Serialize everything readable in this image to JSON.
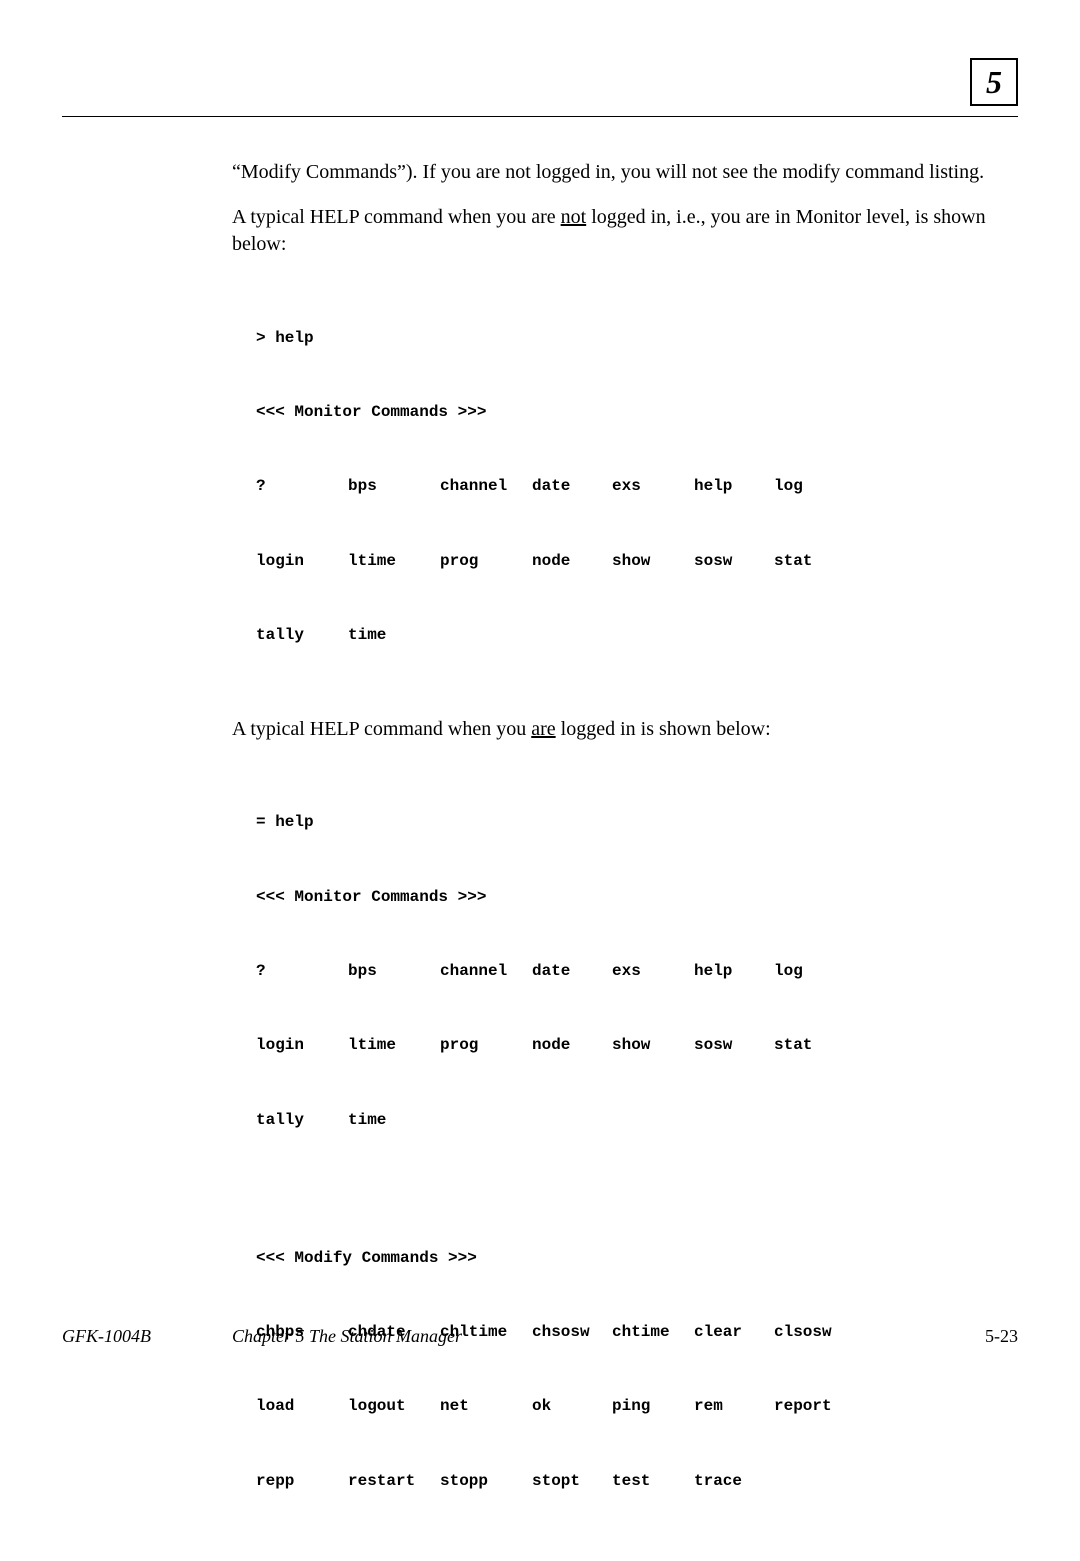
{
  "chapter_num": "5",
  "para1_a": "“Modify Commands”).  If you are not logged in, you will not see the modify command listing.",
  "para2_a": "A typical HELP command when you are ",
  "para2_u": "not",
  "para2_b": " logged in, i.e., you are in Monitor level, is shown below:",
  "para3_a": "A typical HELP command when you ",
  "para3_u": "are",
  "para3_b": " logged in is shown below:",
  "term1": {
    "prompt": "> help",
    "header": "<<< Monitor Commands >>>",
    "rows": [
      [
        "?",
        "bps",
        "channel",
        "date",
        "exs",
        "help",
        "log"
      ],
      [
        "login",
        "ltime",
        "prog",
        "node",
        "show",
        "sosw",
        "stat"
      ],
      [
        "tally",
        "time",
        "",
        "",
        "",
        "",
        ""
      ]
    ]
  },
  "term2": {
    "prompt": "= help",
    "header1": "<<< Monitor Commands >>>",
    "rows1": [
      [
        "?",
        "bps",
        "channel",
        "date",
        "exs",
        "help",
        "log"
      ],
      [
        "login",
        "ltime",
        "prog",
        "node",
        "show",
        "sosw",
        "stat"
      ],
      [
        "tally",
        "time",
        "",
        "",
        "",
        "",
        ""
      ]
    ],
    "header2": "<<< Modify Commands >>>",
    "rows2": [
      [
        "chbps",
        "chdate",
        "chltime",
        "chsosw",
        "chtime",
        "clear",
        "clsosw"
      ],
      [
        "load",
        "logout",
        "net",
        "ok",
        "ping",
        "rem",
        "report"
      ],
      [
        "repp",
        "restart",
        "stopp",
        "stopt",
        "test",
        "trace",
        ""
      ]
    ]
  },
  "footer": {
    "doc": "GFK-1004B",
    "chapter": "Chapter 5  The Station Manager",
    "page": "5-23"
  }
}
